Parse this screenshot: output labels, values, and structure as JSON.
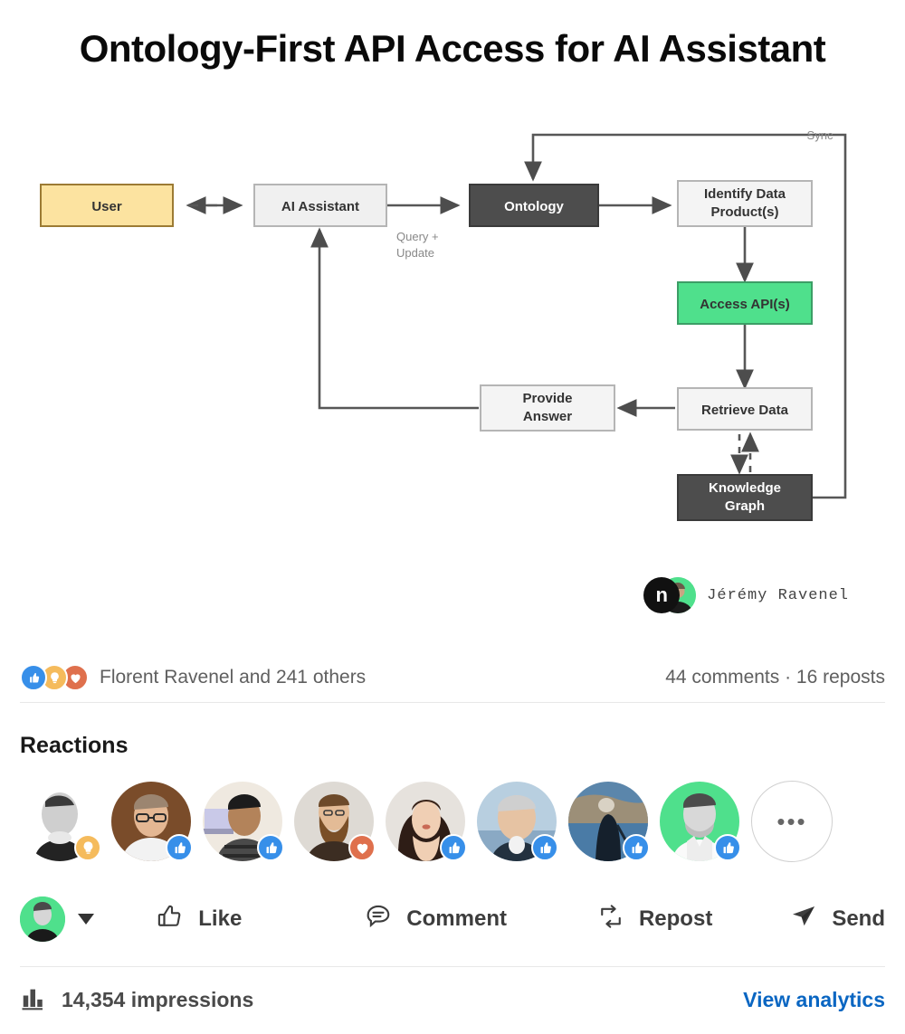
{
  "post": {
    "title": "Ontology-First API Access for AI Assistant",
    "author_name": "Jérémy Ravenel",
    "author_logo_letter": "n"
  },
  "diagram": {
    "nodes": [
      {
        "id": "user",
        "label": "User",
        "fill": "#fce3a0",
        "stroke": "#9c7b34",
        "text": "#4a3510"
      },
      {
        "id": "assistant",
        "label": "AI Assistant",
        "fill": "#f0f0f0",
        "stroke": "#b5b5b5",
        "text": "#333333"
      },
      {
        "id": "ontology",
        "label": "Ontology",
        "fill": "#4d4d4d",
        "stroke": "#3a3a3a",
        "text": "#ffffff"
      },
      {
        "id": "identify",
        "label": "Identify Data Product(s)",
        "fill": "#f4f4f4",
        "stroke": "#b5b5b5",
        "text": "#333333"
      },
      {
        "id": "access",
        "label": "Access API(s)",
        "fill": "#4fe08c",
        "stroke": "#3c9e66",
        "text": "#1d3f2b"
      },
      {
        "id": "retrieve",
        "label": "Retrieve Data",
        "fill": "#f4f4f4",
        "stroke": "#b5b5b5",
        "text": "#333333"
      },
      {
        "id": "provide",
        "label": "Provide Answer",
        "fill": "#f4f4f4",
        "stroke": "#b5b5b5",
        "text": "#333333"
      },
      {
        "id": "kgraph",
        "label": "Knowledge Graph",
        "fill": "#4d4d4d",
        "stroke": "#3a3a3a",
        "text": "#ffffff"
      }
    ],
    "edge_labels": {
      "query_update": "Query + Update",
      "sync": "Sync"
    },
    "node_label_lines": {
      "identify_l1": "Identify Data",
      "identify_l2": "Product(s)",
      "provide_l1": "Provide",
      "provide_l2": "Answer",
      "kgraph_l1": "Knowledge",
      "kgraph_l2": "Graph",
      "query_l1": "Query +",
      "query_l2": "Update"
    }
  },
  "social": {
    "reaction_icons": [
      "like-icon",
      "insightful-icon",
      "love-icon"
    ],
    "reaction_summary": "Florent Ravenel and 241 others",
    "comments_reposts": "44 comments · 16 reposts"
  },
  "reactions_section": {
    "heading": "Reactions",
    "overflow_label": "•••",
    "avatars": [
      {
        "badge": "insightful-icon"
      },
      {
        "badge": "like-icon"
      },
      {
        "badge": "like-icon"
      },
      {
        "badge": "love-icon"
      },
      {
        "badge": "like-icon"
      },
      {
        "badge": "like-icon"
      },
      {
        "badge": "like-icon"
      },
      {
        "badge": "like-icon"
      }
    ]
  },
  "actions": {
    "like": "Like",
    "comment": "Comment",
    "repost": "Repost",
    "send": "Send"
  },
  "analytics": {
    "impressions": "14,354 impressions",
    "view_link": "View analytics"
  },
  "colors": {
    "link_blue": "#0a66c2",
    "like_blue": "#378fe9",
    "insightful_amber": "#f5bb5c",
    "love_red": "#df704d",
    "accent_green": "#4fe08c"
  }
}
